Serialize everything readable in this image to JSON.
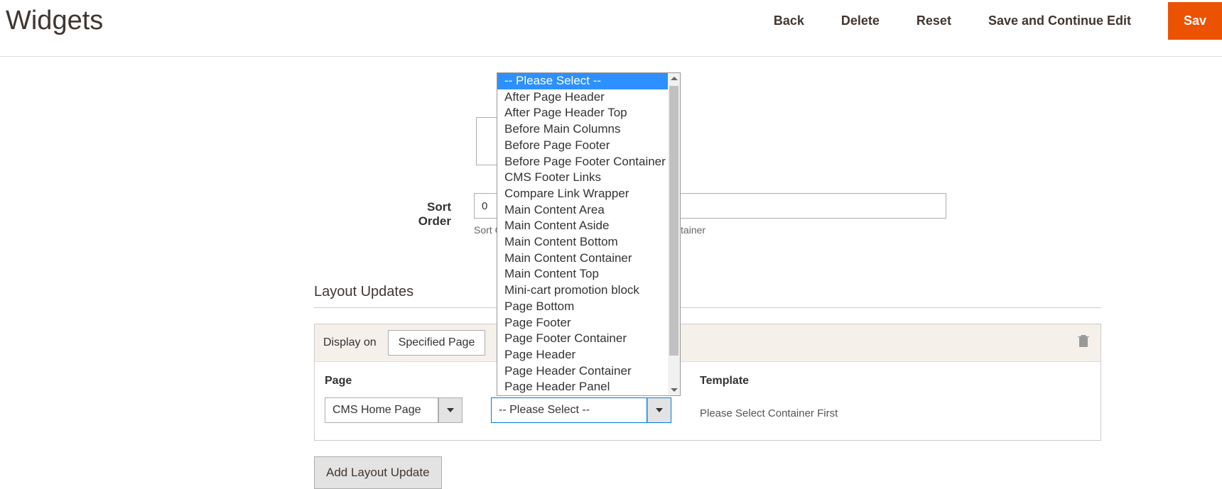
{
  "header": {
    "title": "Widgets",
    "actions": {
      "back": "Back",
      "delete": "Delete",
      "reset": "Reset",
      "save_continue": "Save and Continue Edit",
      "save": "Sav"
    }
  },
  "fields": {
    "sort_order": {
      "label": "Sort Order",
      "value": "0",
      "hint": "Sort Order of widget instances in the same container"
    }
  },
  "layout_updates": {
    "title": "Layout Updates",
    "display_on_label": "Display on",
    "display_on_value": "Specified Page",
    "page": {
      "label": "Page",
      "value": "CMS Home Page"
    },
    "container": {
      "value": "-- Please Select --"
    },
    "template": {
      "label": "Template",
      "hint": "Please Select Container First"
    },
    "add_button": "Add Layout Update"
  },
  "dropdown": {
    "options": [
      "-- Please Select --",
      "After Page Header",
      "After Page Header Top",
      "Before Main Columns",
      "Before Page Footer",
      "Before Page Footer Container",
      "CMS Footer Links",
      "Compare Link Wrapper",
      "Main Content Area",
      "Main Content Aside",
      "Main Content Bottom",
      "Main Content Container",
      "Main Content Top",
      "Mini-cart promotion block",
      "Page Bottom",
      "Page Footer",
      "Page Footer Container",
      "Page Header",
      "Page Header Container",
      "Page Header Panel"
    ]
  }
}
